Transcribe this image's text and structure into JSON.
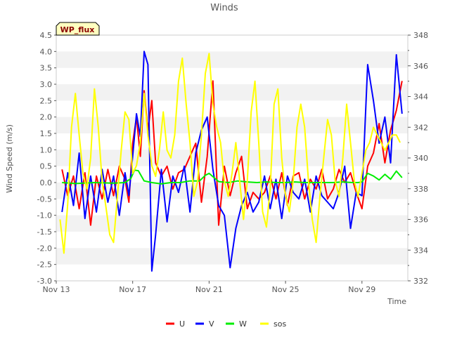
{
  "chart_data": {
    "type": "line",
    "title": "Winds",
    "xlabel": "Time",
    "ylabel": "Wind Speed (m/s)",
    "station_label": "WP_flux",
    "x_unit": "days since Nov 13",
    "xlim": [
      0,
      18.4
    ],
    "x_ticks": [
      {
        "x": 0,
        "label": "Nov 13"
      },
      {
        "x": 4,
        "label": "Nov 17"
      },
      {
        "x": 8,
        "label": "Nov 21"
      },
      {
        "x": 12,
        "label": "Nov 25"
      },
      {
        "x": 16,
        "label": "Nov 29"
      }
    ],
    "ylim": [
      -3.0,
      4.5
    ],
    "y_ticks": [
      "-3.0",
      "-2.5",
      "-2.0",
      "-1.5",
      "-1.0",
      "-0.5",
      "0.0",
      "0.5",
      "1.0",
      "1.5",
      "2.0",
      "2.5",
      "3.0",
      "3.5",
      "4.0",
      "4.5"
    ],
    "y2lim": [
      332,
      348
    ],
    "y2_ticks": [
      "332",
      "334",
      "336",
      "338",
      "340",
      "342",
      "344",
      "346",
      "348"
    ],
    "grid": "horizontal bands",
    "legend_position": "bottom",
    "series": [
      {
        "name": "U",
        "color": "#ff0000",
        "axis": "left",
        "x": [
          0.3,
          0.6,
          0.9,
          1.2,
          1.5,
          1.8,
          2.1,
          2.4,
          2.7,
          3.0,
          3.3,
          3.6,
          3.8,
          4.0,
          4.2,
          4.4,
          4.6,
          4.8,
          5.0,
          5.2,
          5.5,
          5.8,
          6.1,
          6.4,
          6.7,
          7.0,
          7.3,
          7.6,
          7.9,
          8.2,
          8.5,
          8.8,
          9.1,
          9.4,
          9.7,
          10.0,
          10.3,
          10.6,
          10.9,
          11.2,
          11.5,
          11.8,
          12.1,
          12.4,
          12.7,
          13.0,
          13.3,
          13.6,
          13.9,
          14.2,
          14.5,
          14.8,
          15.1,
          15.4,
          15.7,
          16.0,
          16.3,
          16.6,
          16.9,
          17.2,
          17.5,
          17.8,
          18.1
        ],
        "values": [
          0.4,
          -0.4,
          0.2,
          -0.8,
          0.3,
          -1.3,
          0.2,
          -0.5,
          0.4,
          -0.4,
          0.5,
          0.1,
          -0.6,
          1.2,
          2.0,
          0.8,
          2.8,
          1.6,
          2.5,
          0.6,
          0.2,
          0.5,
          -0.2,
          0.3,
          0.4,
          0.8,
          1.2,
          -0.6,
          0.8,
          3.1,
          -1.3,
          0.5,
          -0.4,
          0.3,
          0.8,
          -0.8,
          -0.3,
          -0.5,
          -0.3,
          0.2,
          -0.5,
          0.3,
          -0.7,
          0.2,
          0.3,
          -0.5,
          0.1,
          -0.2,
          0.4,
          -0.5,
          -0.2,
          0.4,
          0.0,
          0.3,
          -0.3,
          -0.8,
          0.5,
          0.9,
          1.8,
          0.6,
          1.6,
          2.2,
          3.1
        ]
      },
      {
        "name": "V",
        "color": "#0000ff",
        "axis": "left",
        "x": [
          0.3,
          0.6,
          0.9,
          1.2,
          1.5,
          1.8,
          2.1,
          2.4,
          2.7,
          3.0,
          3.3,
          3.6,
          3.8,
          4.0,
          4.2,
          4.4,
          4.6,
          4.8,
          5.0,
          5.2,
          5.5,
          5.8,
          6.1,
          6.4,
          6.7,
          7.0,
          7.3,
          7.6,
          7.9,
          8.2,
          8.5,
          8.8,
          9.1,
          9.4,
          9.7,
          10.0,
          10.3,
          10.6,
          10.9,
          11.2,
          11.5,
          11.8,
          12.1,
          12.4,
          12.7,
          13.0,
          13.3,
          13.6,
          13.9,
          14.2,
          14.5,
          14.8,
          15.1,
          15.4,
          15.7,
          16.0,
          16.3,
          16.6,
          16.9,
          17.2,
          17.5,
          17.8,
          18.1
        ],
        "values": [
          -0.9,
          0.3,
          -0.7,
          0.9,
          -1.1,
          0.2,
          -0.9,
          0.4,
          -0.6,
          0.2,
          -1.0,
          0.3,
          -0.4,
          0.8,
          2.1,
          1.4,
          4.0,
          3.6,
          -2.7,
          -1.6,
          0.4,
          -1.2,
          0.2,
          -0.3,
          0.5,
          -0.9,
          0.9,
          1.6,
          2.0,
          0.4,
          -0.7,
          -1.0,
          -2.6,
          -1.4,
          -0.7,
          -0.3,
          -0.9,
          -0.6,
          0.2,
          -0.8,
          0.1,
          -1.1,
          0.2,
          -0.3,
          -0.5,
          0.1,
          -0.9,
          0.2,
          -0.4,
          -0.6,
          -0.8,
          -0.3,
          0.5,
          -1.4,
          -0.3,
          -0.4,
          3.6,
          2.5,
          1.2,
          2.0,
          0.6,
          3.9,
          2.1
        ]
      },
      {
        "name": "W",
        "color": "#00ee00",
        "axis": "left",
        "x": [
          0.3,
          1.0,
          2.0,
          3.0,
          3.6,
          3.9,
          4.1,
          4.3,
          4.6,
          5.0,
          5.5,
          6.0,
          6.5,
          7.0,
          7.5,
          7.8,
          8.0,
          8.2,
          8.5,
          9.0,
          9.5,
          10.0,
          10.5,
          11.0,
          11.5,
          12.0,
          12.5,
          13.0,
          13.5,
          14.0,
          14.5,
          15.0,
          15.5,
          15.8,
          16.0,
          16.3,
          16.6,
          16.9,
          17.2,
          17.5,
          17.8,
          18.1
        ],
        "values": [
          0.0,
          -0.03,
          0.0,
          -0.02,
          0.0,
          0.12,
          0.38,
          0.36,
          0.05,
          0.0,
          -0.04,
          0.0,
          0.0,
          0.05,
          0.05,
          0.22,
          0.28,
          0.18,
          0.03,
          0.0,
          0.05,
          0.02,
          0.0,
          0.02,
          0.0,
          0.0,
          0.02,
          0.0,
          0.0,
          0.0,
          0.0,
          0.02,
          0.0,
          0.0,
          0.02,
          0.28,
          0.2,
          0.08,
          0.25,
          0.1,
          0.35,
          0.15
        ]
      },
      {
        "name": "sos",
        "color": "#ffff00",
        "axis": "right",
        "x": [
          0.2,
          0.4,
          0.6,
          0.8,
          1.0,
          1.2,
          1.4,
          1.6,
          1.8,
          2.0,
          2.2,
          2.4,
          2.6,
          2.8,
          3.0,
          3.2,
          3.4,
          3.6,
          3.8,
          4.0,
          4.2,
          4.4,
          4.6,
          4.8,
          5.0,
          5.2,
          5.4,
          5.6,
          5.8,
          6.0,
          6.2,
          6.4,
          6.6,
          6.8,
          7.0,
          7.2,
          7.4,
          7.6,
          7.8,
          8.0,
          8.2,
          8.4,
          8.6,
          8.8,
          9.0,
          9.2,
          9.4,
          9.6,
          9.8,
          10.0,
          10.2,
          10.4,
          10.6,
          10.8,
          11.0,
          11.2,
          11.4,
          11.6,
          11.8,
          12.0,
          12.2,
          12.4,
          12.6,
          12.8,
          13.0,
          13.2,
          13.4,
          13.6,
          13.8,
          14.0,
          14.2,
          14.4,
          14.6,
          14.8,
          15.0,
          15.2,
          15.4,
          15.6,
          15.8,
          16.0,
          16.2,
          16.4,
          16.6,
          16.8,
          17.0,
          17.2,
          17.4,
          17.6,
          17.8,
          18.0
        ],
        "values": [
          336.0,
          333.8,
          337.0,
          342.0,
          344.2,
          341.5,
          339.0,
          338.0,
          340.0,
          344.5,
          342.0,
          338.5,
          336.8,
          335.0,
          334.5,
          337.5,
          340.5,
          343.0,
          342.5,
          339.0,
          339.5,
          341.0,
          344.2,
          341.5,
          339.5,
          338.8,
          340.5,
          343.0,
          340.5,
          340.0,
          341.5,
          345.0,
          346.5,
          343.5,
          341.0,
          337.5,
          338.5,
          341.5,
          345.5,
          346.8,
          343.5,
          342.0,
          341.0,
          338.5,
          337.5,
          339.0,
          341.0,
          338.5,
          336.0,
          338.5,
          343.0,
          345.0,
          341.0,
          336.5,
          335.5,
          338.0,
          343.5,
          344.5,
          340.0,
          337.5,
          336.5,
          338.5,
          342.0,
          343.5,
          342.0,
          338.5,
          336.0,
          334.5,
          337.5,
          340.0,
          342.5,
          341.5,
          338.5,
          337.5,
          340.0,
          343.5,
          341.0,
          338.5,
          337.5,
          339.0,
          340.5,
          341.0,
          342.0,
          341.5,
          341.0,
          340.5,
          341.0,
          341.5,
          341.5,
          341.0
        ]
      }
    ]
  }
}
